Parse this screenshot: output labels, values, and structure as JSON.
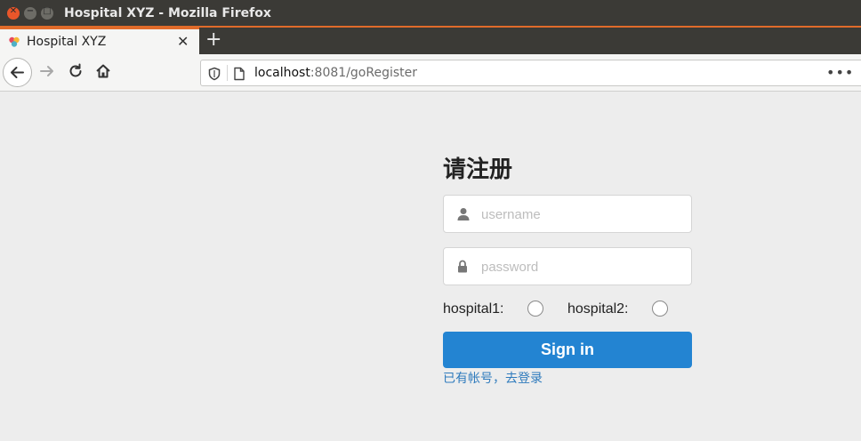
{
  "window": {
    "title": "Hospital XYZ - Mozilla Firefox",
    "close_glyph": "✕",
    "min_glyph": "−",
    "max_glyph": "□"
  },
  "tab": {
    "title": "Hospital XYZ",
    "close_glyph": "✕",
    "new_tab_glyph": "+"
  },
  "navbar": {
    "url_host": "localhost",
    "url_path": ":8081/goRegister",
    "more_glyph": "•••"
  },
  "form": {
    "heading": "请注册",
    "username_placeholder": "username",
    "password_placeholder": "password",
    "hospital1_label": "hospital1:",
    "hospital2_label": "hospital2:",
    "signin_label": "Sign in",
    "login_link": "已有帐号，去登录"
  },
  "colors": {
    "accent": "#e06b2a",
    "button": "#2384d2",
    "link": "#2f7bbd"
  }
}
